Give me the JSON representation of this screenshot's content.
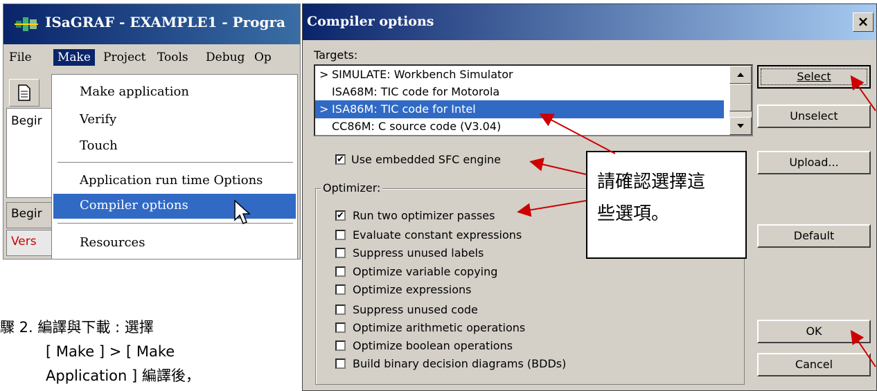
{
  "main_window": {
    "title": "ISaGRAF - EXAMPLE1 - Progra",
    "menu": [
      "File",
      "Make",
      "Project",
      "Tools",
      "Debug",
      "Op"
    ],
    "pane_text": "Begir",
    "status_text_1": "Begir",
    "status_text_2": "Vers"
  },
  "make_menu": {
    "items": [
      "Make application",
      "Verify",
      "Touch",
      "Application run time Options",
      "Compiler options",
      "Resources"
    ],
    "selected": "Compiler options"
  },
  "dialog": {
    "title": "Compiler options",
    "close_label": "×",
    "targets_label": "Targets:",
    "targets": [
      {
        "mark": ">",
        "label": "SIMULATE: Workbench Simulator",
        "selected": false
      },
      {
        "mark": "",
        "label": "ISA68M: TIC code for Motorola",
        "selected": false
      },
      {
        "mark": ">",
        "label": "ISA86M: TIC code for Intel",
        "selected": true
      },
      {
        "mark": "",
        "label": "CC86M: C source code (V3.04)",
        "selected": false
      }
    ],
    "embedded_sfc": {
      "label": "Use embedded SFC engine",
      "checked": true
    },
    "optimizer_label": "Optimizer:",
    "optimizer_options": [
      {
        "label": "Run two optimizer passes",
        "checked": true
      },
      {
        "label": "Evaluate constant expressions",
        "checked": false
      },
      {
        "label": "Suppress unused labels",
        "checked": false
      },
      {
        "label": "Optimize variable copying",
        "checked": false
      },
      {
        "label": "Optimize expressions",
        "checked": false
      },
      {
        "label": "Suppress unused code",
        "checked": false
      },
      {
        "label": "Optimize arithmetic operations",
        "checked": false
      },
      {
        "label": "Optimize boolean operations",
        "checked": false
      },
      {
        "label": "Build binary decision diagrams (BDDs)",
        "checked": false
      }
    ],
    "buttons": {
      "select": "Select",
      "unselect": "Unselect",
      "upload": "Upload...",
      "default": "Default",
      "ok": "OK",
      "cancel": "Cancel"
    }
  },
  "callout": {
    "line1": "請確認選擇這",
    "line2": "些選項。"
  },
  "caption": {
    "line1": "驟 2. 編譯與下載 : 選擇",
    "line2": "[ Make ] > [ Make",
    "line3": "Application ] 編譯後，"
  },
  "colors": {
    "title_blue": "#0a246a",
    "selection_blue": "#316ac5",
    "arrow_red": "#cc0000",
    "face_gray": "#d4d0c8"
  }
}
